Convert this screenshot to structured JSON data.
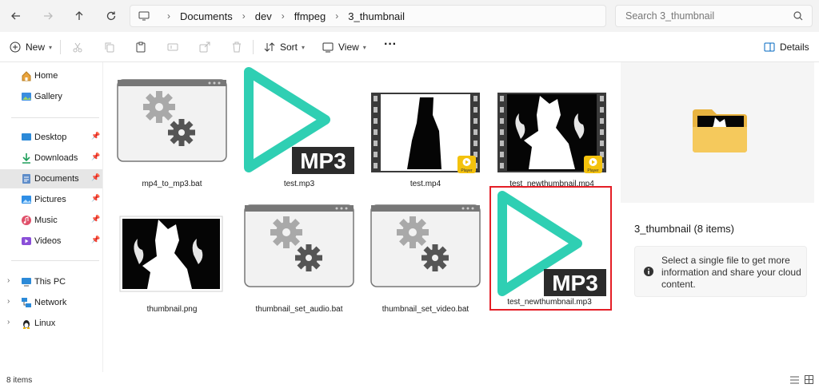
{
  "nav": {
    "back": "back-arrow",
    "forward": "forward-arrow",
    "up": "up-arrow",
    "refresh": "refresh"
  },
  "breadcrumb": [
    "Documents",
    "dev",
    "ffmpeg",
    "3_thumbnail"
  ],
  "search": {
    "placeholder": "Search 3_thumbnail"
  },
  "toolbar": {
    "new_label": "New",
    "sort_label": "Sort",
    "view_label": "View",
    "more_label": "···",
    "details_label": "Details"
  },
  "sidebar": {
    "quick": [
      {
        "label": "Home",
        "icon": "home-icon"
      },
      {
        "label": "Gallery",
        "icon": "gallery-icon"
      }
    ],
    "pinned": [
      {
        "label": "Desktop",
        "icon": "desktop-icon"
      },
      {
        "label": "Downloads",
        "icon": "downloads-icon"
      },
      {
        "label": "Documents",
        "icon": "documents-icon",
        "selected": true
      },
      {
        "label": "Pictures",
        "icon": "pictures-icon"
      },
      {
        "label": "Music",
        "icon": "music-icon"
      },
      {
        "label": "Videos",
        "icon": "videos-icon"
      }
    ],
    "roots": [
      {
        "label": "This PC",
        "icon": "pc-icon"
      },
      {
        "label": "Network",
        "icon": "network-icon"
      },
      {
        "label": "Linux",
        "icon": "linux-icon"
      }
    ]
  },
  "files": [
    {
      "name": "mp4_to_mp3.bat",
      "kind": "bat"
    },
    {
      "name": "test.mp3",
      "kind": "mp3"
    },
    {
      "name": "test.mp4",
      "kind": "mp4"
    },
    {
      "name": "test_newthumbnail.mp4",
      "kind": "mp4"
    },
    {
      "name": "thumbnail.png",
      "kind": "png"
    },
    {
      "name": "thumbnail_set_audio.bat",
      "kind": "bat"
    },
    {
      "name": "thumbnail_set_video.bat",
      "kind": "bat"
    },
    {
      "name": "test_newthumbnail.mp3",
      "kind": "mp3",
      "selected": true
    }
  ],
  "badges": {
    "mp3": "MP3",
    "player": "Player"
  },
  "details_pane": {
    "title": "3_thumbnail (8 items)",
    "message": "Select a single file to get more information and share your cloud content."
  },
  "status": {
    "count": "8 items"
  },
  "colors": {
    "accent": "#0067c0",
    "selection_outline": "#e41e26",
    "mp3_play": "#2fcfb3"
  }
}
